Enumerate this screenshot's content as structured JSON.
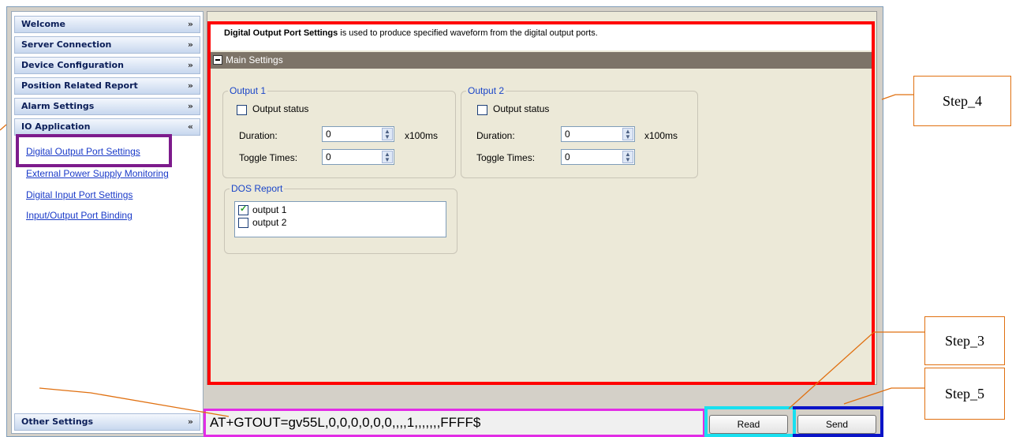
{
  "sidebar": {
    "sections": [
      {
        "label": "Welcome",
        "chevron": "»"
      },
      {
        "label": "Server Connection",
        "chevron": "»"
      },
      {
        "label": "Device Configuration",
        "chevron": "»"
      },
      {
        "label": "Position Related Report",
        "chevron": "»"
      },
      {
        "label": "Alarm Settings",
        "chevron": "»"
      },
      {
        "label": "IO Application",
        "chevron": "«"
      }
    ],
    "links": [
      "Digital Output Port Settings",
      "External Power Supply Monitoring",
      "Digital Input Port Settings",
      "Input/Output Port Binding"
    ],
    "bottom_section": {
      "label": "Other Settings",
      "chevron": "»"
    }
  },
  "content": {
    "description_title": "Digital Output Port Settings",
    "description_text": " is used to produce specified waveform from the digital output ports.",
    "main_settings_label": "Main Settings",
    "outputs": [
      {
        "legend": "Output 1",
        "status_label": "Output status",
        "status_checked": false,
        "duration_label": "Duration:",
        "duration_value": "0",
        "duration_unit": "x100ms",
        "toggle_label": "Toggle Times:",
        "toggle_value": "0"
      },
      {
        "legend": "Output 2",
        "status_label": "Output status",
        "status_checked": false,
        "duration_label": "Duration:",
        "duration_value": "0",
        "duration_unit": "x100ms",
        "toggle_label": "Toggle Times:",
        "toggle_value": "0"
      }
    ],
    "dos_report": {
      "legend": "DOS Report",
      "items": [
        {
          "label": "output 1",
          "checked": true
        },
        {
          "label": "output 2",
          "checked": false
        }
      ]
    }
  },
  "command_bar": {
    "command_text": "AT+GTOUT=gv55L,0,0,0,0,0,0,,,,1,,,,,,,FFFF$",
    "read_label": "Read",
    "send_label": "Send"
  },
  "annotations": {
    "step4": "Step_4",
    "step3": "Step_3",
    "step5": "Step_5"
  },
  "colors": {
    "step4_box": "#ff0000",
    "sidebar_highlight": "#7d1b8c",
    "command_highlight": "#e22ce6",
    "read_highlight": "#19e0f0",
    "send_highlight": "#0a14c8",
    "callout_border": "#e07010"
  }
}
